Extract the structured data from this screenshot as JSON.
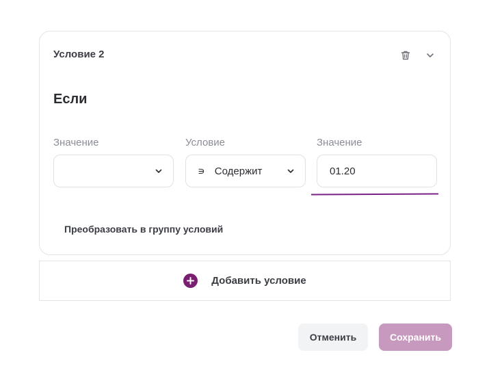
{
  "condition_card": {
    "title": "Условие 2",
    "if_label": "Если",
    "fields": {
      "value_left": {
        "label": "Значение",
        "value": ""
      },
      "condition": {
        "label": "Условие",
        "symbol": "∍",
        "value": "Содержит"
      },
      "value_right": {
        "label": "Значение",
        "value": "01.20"
      }
    },
    "convert_link": "Преобразовать в группу условий"
  },
  "add_condition": {
    "label": "Добавить условие"
  },
  "footer": {
    "cancel_label": "Отменить",
    "save_label": "Сохранить"
  },
  "colors": {
    "accent": "#7a1f6f",
    "save_disabled": "#c899bf",
    "underline": "#7a1f86"
  },
  "icons": {
    "delete": "trash-icon",
    "collapse": "chevron-down-icon",
    "add": "plus-circle-icon"
  }
}
